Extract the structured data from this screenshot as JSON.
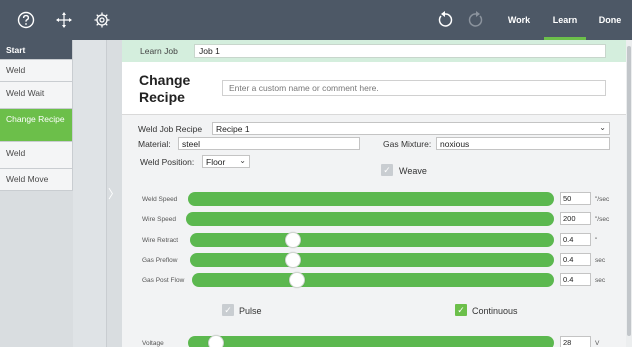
{
  "topbar": {
    "icons": [
      "help-icon",
      "move-icon",
      "settings-icon",
      "undo-icon",
      "redo-icon"
    ],
    "work_label": "Work",
    "learn_label": "Learn",
    "done_label": "Done"
  },
  "sidebar": {
    "items": [
      {
        "label": "Start"
      },
      {
        "label": "Weld"
      },
      {
        "label": "Weld Wait"
      },
      {
        "label": "Change Recipe"
      },
      {
        "label": "Weld"
      },
      {
        "label": "Weld Move"
      }
    ],
    "selected_index": 3
  },
  "learn_job": {
    "label": "Learn Job",
    "value": "Job 1"
  },
  "change_recipe": {
    "title": "Change Recipe",
    "comment_placeholder": "Enter a custom name or comment here."
  },
  "form": {
    "recipe_label": "Weld Job Recipe",
    "recipe_value": "Recipe 1",
    "material_label": "Material:",
    "material_value": "steel",
    "gas_label": "Gas Mixture:",
    "gas_value": "noxious",
    "position_label": "Weld Position:",
    "position_value": "Floor",
    "weave_label": "Weave",
    "weave_checked": false,
    "pulse_label": "Pulse",
    "pulse_checked": false,
    "continuous_label": "Continuous",
    "continuous_checked": true
  },
  "sliders": [
    {
      "label": "Weld Speed",
      "value": "50",
      "unit": "\"/sec",
      "level": 1.0
    },
    {
      "label": "Wire Speed",
      "value": "200",
      "unit": "\"/sec",
      "level": 1.0
    },
    {
      "label": "Wire Retract",
      "value": "0.4",
      "unit": "\"",
      "level": 0.28
    },
    {
      "label": "Gas Preflow",
      "value": "0.4",
      "unit": "sec",
      "level": 0.28
    },
    {
      "label": "Gas Post Flow",
      "value": "0.4",
      "unit": "sec",
      "level": 0.28
    },
    {
      "label": "Voltage",
      "value": "28",
      "unit": "V",
      "level": 0.07
    }
  ],
  "colors": {
    "topbar": "#4d5866",
    "accent_green": "#6cbf4a",
    "slider_green": "#5cb84f",
    "job_row_bg": "#d4eedd"
  }
}
